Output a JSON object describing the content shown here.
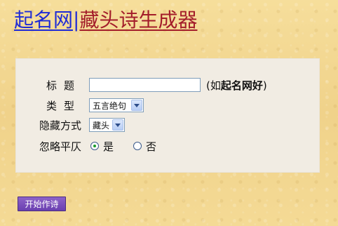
{
  "header": {
    "site_name": "起名网",
    "separator": "|",
    "tool_name": "藏头诗生成器"
  },
  "form": {
    "title_label": "标题",
    "title_value": "",
    "title_hint_prefix": "(如",
    "title_hint_bold": "起名网好",
    "title_hint_suffix": ")",
    "type_label": "类型",
    "type_selected": "五言绝句",
    "hide_label": "隐藏方式",
    "hide_selected": "藏头",
    "tone_label": "忽略平仄",
    "tone_options": [
      {
        "label": "是",
        "selected": true
      },
      {
        "label": "否",
        "selected": false
      }
    ],
    "submit_label": "开始作诗"
  },
  "colors": {
    "site_link": "#1f2bd6",
    "tool_link": "#a31d2a",
    "panel_bg": "#f1ece3",
    "button_bg": "#6a3fb0"
  }
}
